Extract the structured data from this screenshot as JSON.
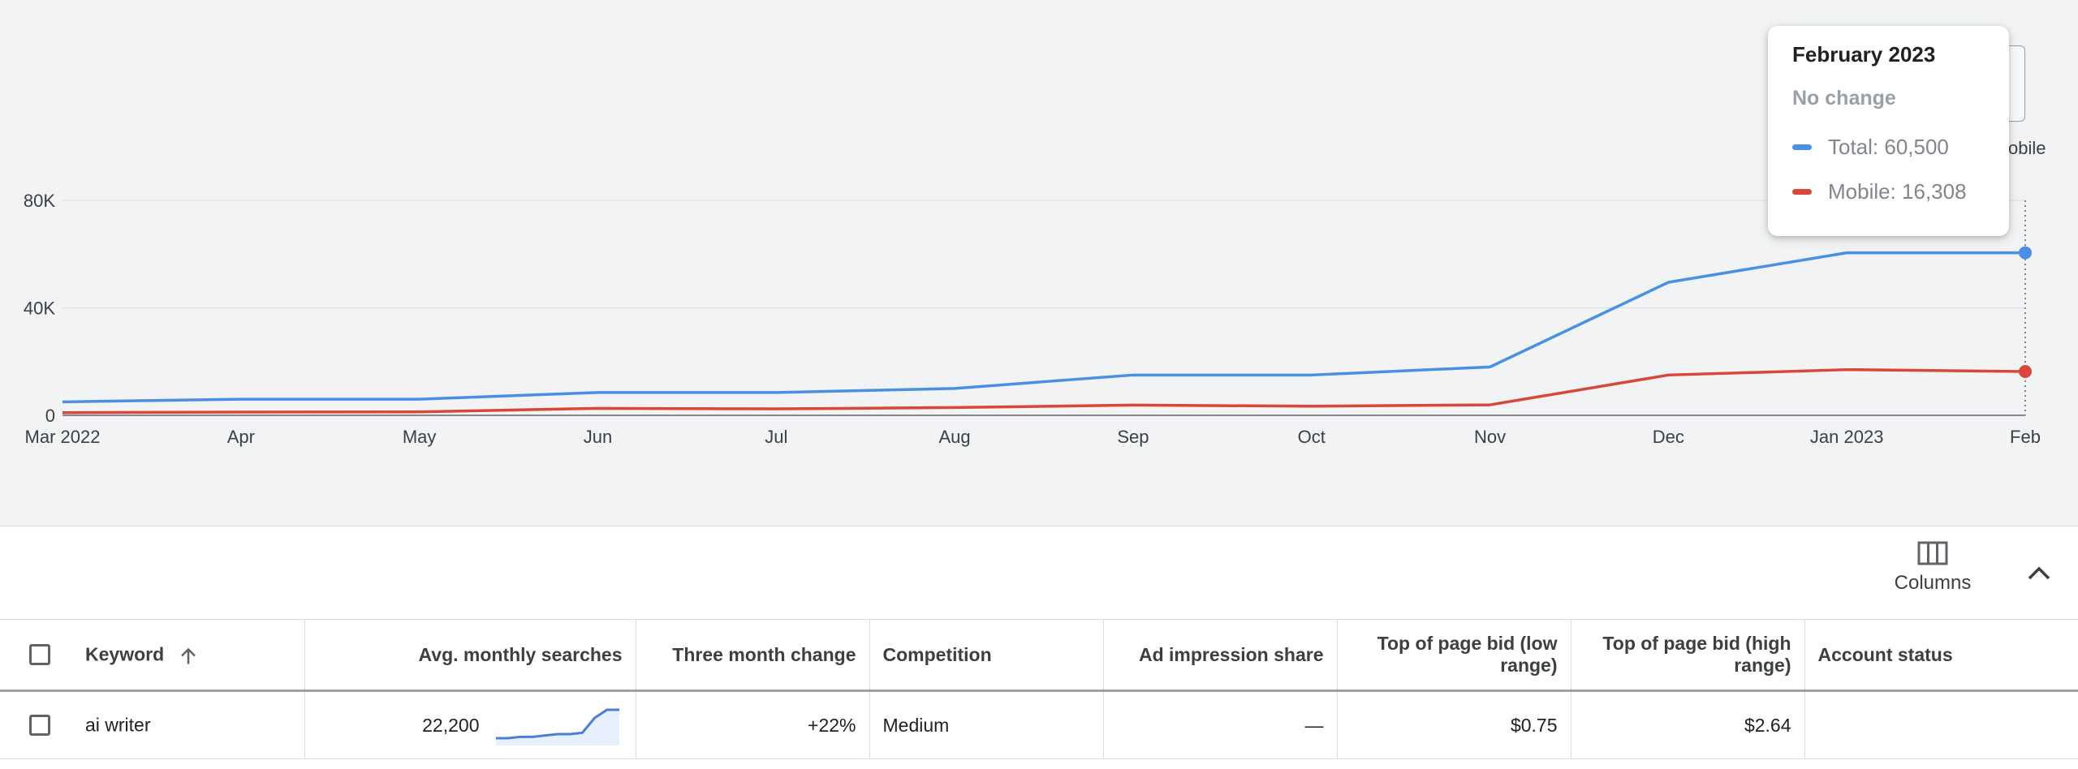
{
  "chart_data": {
    "type": "line",
    "x": [
      "Mar 2022",
      "Apr",
      "May",
      "Jun",
      "Jul",
      "Aug",
      "Sep",
      "Oct",
      "Nov",
      "Dec",
      "Jan 2023",
      "Feb"
    ],
    "series": [
      {
        "name": "Total",
        "color": "#4a90e2",
        "values": [
          5000,
          6000,
          6000,
          8500,
          8500,
          10000,
          15000,
          15000,
          18000,
          49500,
          60500,
          60500
        ]
      },
      {
        "name": "Mobile",
        "color": "#d9473c",
        "values": [
          1000,
          1200,
          1300,
          2600,
          2400,
          2900,
          3800,
          3400,
          3900,
          15000,
          17000,
          16308
        ]
      }
    ],
    "y_ticks": [
      "0",
      "40K",
      "80K"
    ],
    "ylim": [
      0,
      80000
    ],
    "grid": true
  },
  "tooltip": {
    "title": "February 2023",
    "subtitle": "No change",
    "rows": [
      {
        "label": "Total: 60,500",
        "color": "#4a90e2"
      },
      {
        "label": "Mobile: 16,308",
        "color": "#d9473c"
      }
    ]
  },
  "legend_peek": "obile",
  "toolbar": {
    "columns_label": "Columns",
    "columns_icon": "columns-icon",
    "collapse_icon": "chevron-up-icon"
  },
  "table": {
    "headers": {
      "keyword": "Keyword",
      "avg": "Avg. monthly searches",
      "three_month": "Three month change",
      "competition": "Competition",
      "impression": "Ad impression share",
      "bid_low": "Top of page bid (low range)",
      "bid_high": "Top of page bid (high range)",
      "status": "Account status"
    },
    "rows": [
      {
        "keyword": "ai writer",
        "avg": "22,200",
        "three_month": "+22%",
        "competition": "Medium",
        "impression": "—",
        "bid_low": "$0.75",
        "bid_high": "$2.64",
        "status": "",
        "sparkline": [
          3,
          3,
          4,
          4,
          5,
          6,
          6,
          7,
          18,
          24,
          24
        ]
      }
    ]
  }
}
